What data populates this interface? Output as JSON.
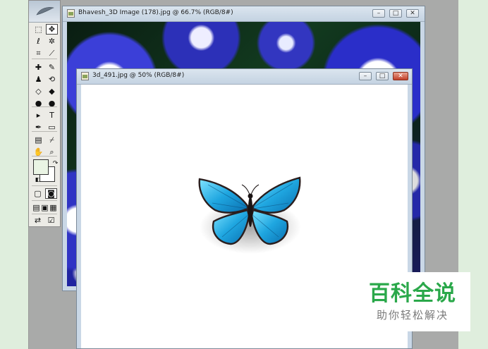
{
  "windows": {
    "back": {
      "title": "Bhavesh_3D Image (178).jpg @ 66.7% (RGB/8#)"
    },
    "front": {
      "title": "3d_491.jpg @ 50% (RGB/8#)"
    }
  },
  "window_buttons": {
    "minimize": "–",
    "maximize": "□",
    "close": "✕"
  },
  "toolbox": {
    "tools": [
      {
        "name": "marquee-tool",
        "glyph": "⬚"
      },
      {
        "name": "move-tool",
        "glyph": "✥"
      },
      {
        "name": "lasso-tool",
        "glyph": "ℓ"
      },
      {
        "name": "magic-wand-tool",
        "glyph": "✲"
      },
      {
        "name": "crop-tool",
        "glyph": "⌗"
      },
      {
        "name": "slice-tool",
        "glyph": "⟋"
      },
      {
        "name": "healing-brush-tool",
        "glyph": "✚"
      },
      {
        "name": "brush-tool",
        "glyph": "✎"
      },
      {
        "name": "clone-stamp-tool",
        "glyph": "♟"
      },
      {
        "name": "history-brush-tool",
        "glyph": "⟲"
      },
      {
        "name": "eraser-tool",
        "glyph": "◇"
      },
      {
        "name": "paint-bucket-tool",
        "glyph": "◆"
      },
      {
        "name": "blur-tool",
        "glyph": "●"
      },
      {
        "name": "dodge-tool",
        "glyph": "●"
      },
      {
        "name": "path-select-tool",
        "glyph": "▸"
      },
      {
        "name": "type-tool",
        "glyph": "T"
      },
      {
        "name": "pen-tool",
        "glyph": "✒"
      },
      {
        "name": "shape-tool",
        "glyph": "▭"
      },
      {
        "name": "notes-tool",
        "glyph": "▤"
      },
      {
        "name": "eyedropper-tool",
        "glyph": "⌿"
      },
      {
        "name": "hand-tool",
        "glyph": "✋"
      },
      {
        "name": "zoom-tool",
        "glyph": "⌕"
      }
    ]
  },
  "colors": {
    "foreground": "#eaf4e4",
    "background": "#ffffff",
    "watermark_green": "#2aa84a"
  },
  "watermark": {
    "title": "百科全说",
    "subtitle": "助你轻松解决"
  }
}
